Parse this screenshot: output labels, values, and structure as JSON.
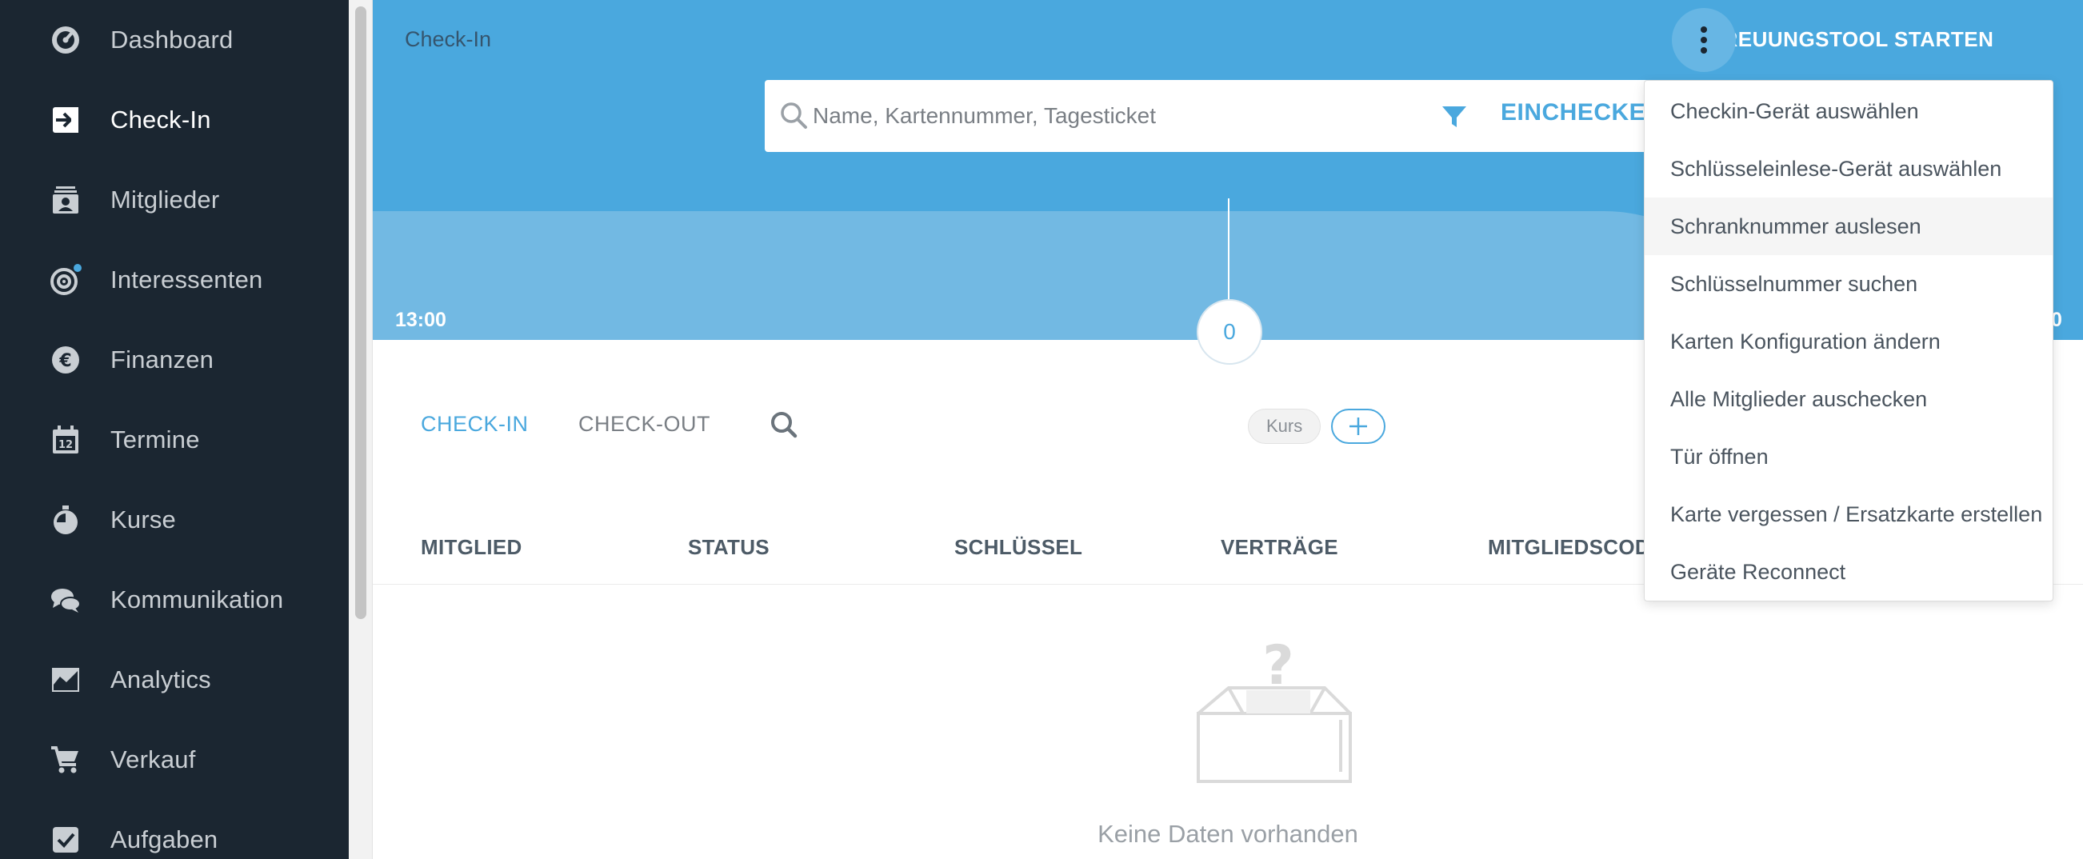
{
  "sidebar": {
    "items": [
      {
        "label": "Dashboard",
        "icon": "dashboard-icon"
      },
      {
        "label": "Check-In",
        "icon": "checkin-icon",
        "active": true
      },
      {
        "label": "Mitglieder",
        "icon": "members-icon"
      },
      {
        "label": "Interessenten",
        "icon": "prospects-icon",
        "badge": true
      },
      {
        "label": "Finanzen",
        "icon": "euro-icon"
      },
      {
        "label": "Termine",
        "icon": "calendar-icon"
      },
      {
        "label": "Kurse",
        "icon": "stopwatch-icon"
      },
      {
        "label": "Kommunikation",
        "icon": "chat-icon"
      },
      {
        "label": "Analytics",
        "icon": "chart-icon"
      },
      {
        "label": "Verkauf",
        "icon": "cart-icon"
      },
      {
        "label": "Aufgaben",
        "icon": "checkbox-icon"
      }
    ]
  },
  "header": {
    "breadcrumb": "Check-In",
    "action_label": "BETREUUNGSTOOL STARTEN",
    "search_placeholder": "Name, Kartennummer, Tagesticket",
    "checkin_button": "EINCHECKEN",
    "time_start": "13:00",
    "time_end": "0",
    "count": "0"
  },
  "main": {
    "tabs": [
      {
        "label": "CHECK-IN",
        "active": true
      },
      {
        "label": "CHECK-OUT",
        "active": false
      }
    ],
    "chip_label": "Kurs",
    "columns": [
      "MITGLIED",
      "STATUS",
      "SCHLÜSSEL",
      "VERTRÄGE",
      "MITGLIEDSCODE"
    ],
    "empty_text": "Keine Daten vorhanden"
  },
  "menu": {
    "items": [
      "Checkin-Gerät auswählen",
      "Schlüsseleinlese-Gerät auswählen",
      "Schranknummer auslesen",
      "Schlüsselnummer suchen",
      "Karten Konfiguration ändern",
      "Alle Mitglieder auschecken",
      "Tür öffnen",
      "Karte vergessen / Ersatzkarte erstellen",
      "Geräte Reconnect"
    ],
    "hovered_index": 2
  },
  "colors": {
    "sidebar_bg": "#1b2631",
    "accent": "#4aa8de",
    "header_hill": "#72b9e3"
  }
}
